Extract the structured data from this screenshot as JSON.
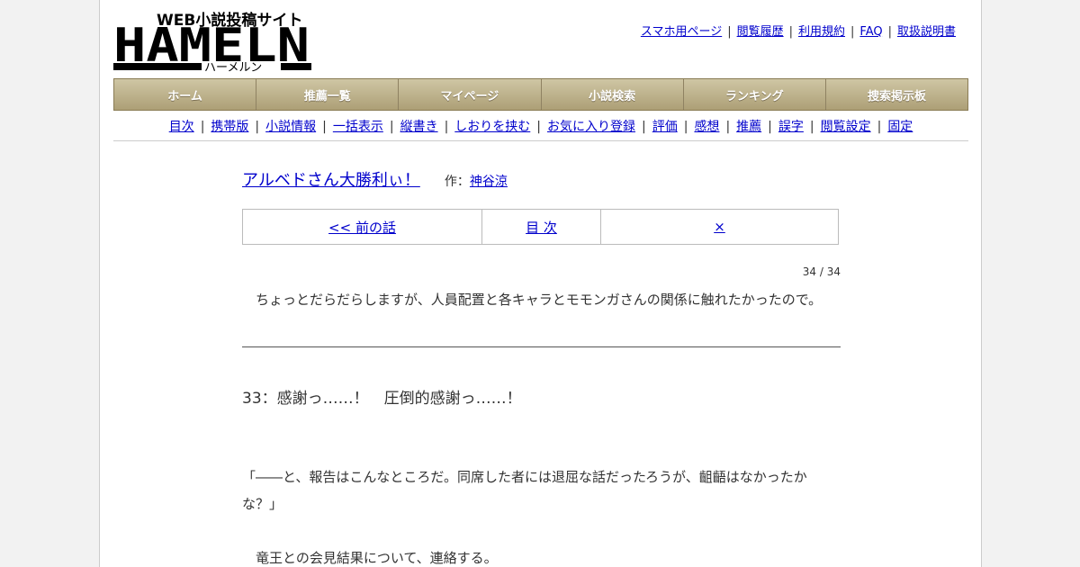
{
  "header": {
    "logo_tagline": "WEB小説投稿サイト",
    "logo_name": "HAMELN",
    "logo_kana": "ハーメルン",
    "links": [
      "スマホ用ページ",
      "閲覧履歴",
      "利用規約",
      "FAQ",
      "取扱説明書"
    ]
  },
  "main_nav": [
    "ホーム",
    "推薦一覧",
    "マイページ",
    "小説検索",
    "ランキング",
    "捜索掲示板"
  ],
  "sub_nav": [
    "目次",
    "携帯版",
    "小説情報",
    "一括表示",
    "縦書き",
    "しおりを挟む",
    "お気に入り登録",
    "評価",
    "感想",
    "推薦",
    "誤字",
    "閲覧設定",
    "固定"
  ],
  "novel": {
    "title": "アルベドさん大勝利ぃ！",
    "author_prefix": "作：",
    "author": "神谷涼"
  },
  "pager": {
    "prev": "<< 前の話",
    "toc": "目 次",
    "next": "×"
  },
  "page_count": "34 / 34",
  "preface": "ちょっとだらだらしますが、人員配置と各キャラとモモンガさんの関係に触れたかったので。",
  "chapter_title": "33：感謝っ……！　圧倒的感謝っ……！",
  "body": [
    "「――と、報告はこんなところだ。同席した者には退屈な話だったろうが、齟齬はなかったか",
    "な？」",
    "竜王との会見結果について、連絡する。"
  ],
  "colors": {
    "nav_gradient_top": "#cfc6a4",
    "nav_gradient_bottom": "#ad9f76",
    "link": "#0000cc"
  }
}
